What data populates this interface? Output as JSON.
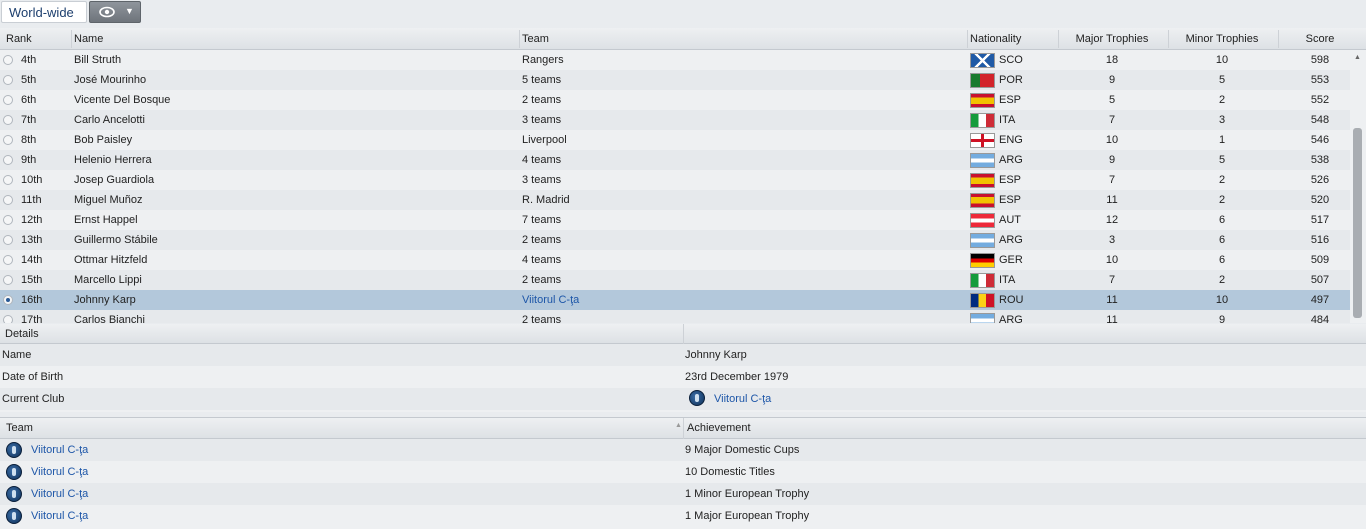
{
  "toolbar": {
    "scope_label": "World-wide",
    "view_icon": "eye-icon",
    "dropdown_icon": "chevron-down-icon"
  },
  "ranking": {
    "headers": {
      "rank": "Rank",
      "name": "Name",
      "team": "Team",
      "nationality": "Nationality",
      "major": "Major Trophies",
      "minor": "Minor Trophies",
      "score": "Score"
    },
    "rows": [
      {
        "rank": "4th",
        "name": "Bill Struth",
        "team": "Rangers",
        "flag": "SCO",
        "major": "18",
        "minor": "10",
        "score": "598"
      },
      {
        "rank": "5th",
        "name": "José Mourinho",
        "team": "5 teams",
        "flag": "POR",
        "major": "9",
        "minor": "5",
        "score": "553"
      },
      {
        "rank": "6th",
        "name": "Vicente Del Bosque",
        "team": "2 teams",
        "flag": "ESP",
        "major": "5",
        "minor": "2",
        "score": "552"
      },
      {
        "rank": "7th",
        "name": "Carlo Ancelotti",
        "team": "3 teams",
        "flag": "ITA",
        "major": "7",
        "minor": "3",
        "score": "548"
      },
      {
        "rank": "8th",
        "name": "Bob Paisley",
        "team": "Liverpool",
        "flag": "ENG",
        "major": "10",
        "minor": "1",
        "score": "546"
      },
      {
        "rank": "9th",
        "name": "Helenio Herrera",
        "team": "4 teams",
        "flag": "ARG",
        "major": "9",
        "minor": "5",
        "score": "538"
      },
      {
        "rank": "10th",
        "name": "Josep Guardiola",
        "team": "3 teams",
        "flag": "ESP",
        "major": "7",
        "minor": "2",
        "score": "526"
      },
      {
        "rank": "11th",
        "name": "Miguel Muñoz",
        "team": "R. Madrid",
        "flag": "ESP",
        "major": "11",
        "minor": "2",
        "score": "520"
      },
      {
        "rank": "12th",
        "name": "Ernst Happel",
        "team": "7 teams",
        "flag": "AUT",
        "major": "12",
        "minor": "6",
        "score": "517"
      },
      {
        "rank": "13th",
        "name": "Guillermo Stábile",
        "team": "2 teams",
        "flag": "ARG",
        "major": "3",
        "minor": "6",
        "score": "516"
      },
      {
        "rank": "14th",
        "name": "Ottmar Hitzfeld",
        "team": "4 teams",
        "flag": "GER",
        "major": "10",
        "minor": "6",
        "score": "509"
      },
      {
        "rank": "15th",
        "name": "Marcello Lippi",
        "team": "2 teams",
        "flag": "ITA",
        "major": "7",
        "minor": "2",
        "score": "507"
      },
      {
        "rank": "16th",
        "name": "Johnny Karp",
        "team": "Viitorul C-ţa",
        "flag": "ROU",
        "major": "11",
        "minor": "10",
        "score": "497",
        "selected": true
      },
      {
        "rank": "17th",
        "name": "Carlos Bianchi",
        "team": "2 teams",
        "flag": "ARG",
        "major": "11",
        "minor": "9",
        "score": "484"
      }
    ]
  },
  "details": {
    "title": "Details",
    "name_label": "Name",
    "name_value": "Johnny Karp",
    "dob_label": "Date of Birth",
    "dob_value": "23rd December 1979",
    "club_label": "Current Club",
    "club_value": "Viitorul C-ţa"
  },
  "achievements": {
    "team_header": "Team",
    "achievement_header": "Achievement",
    "rows": [
      {
        "team": "Viitorul C-ţa",
        "achievement": "9 Major Domestic Cups"
      },
      {
        "team": "Viitorul C-ţa",
        "achievement": "10 Domestic Titles"
      },
      {
        "team": "Viitorul C-ţa",
        "achievement": "1 Minor European Trophy"
      },
      {
        "team": "Viitorul C-ţa",
        "achievement": "1 Major European Trophy"
      }
    ]
  }
}
